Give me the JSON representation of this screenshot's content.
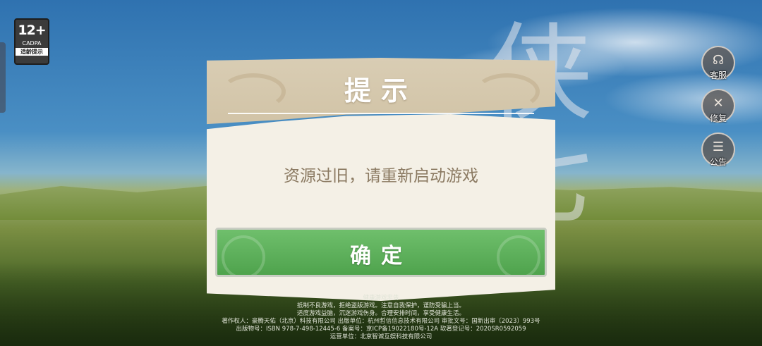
{
  "age_rating": {
    "number": "12+",
    "org": "CADPA",
    "label": "适龄提示"
  },
  "side_menu": [
    {
      "label": "客服",
      "icon": "customer-service-icon",
      "glyph": "☊"
    },
    {
      "label": "修复",
      "icon": "wrench-screwdriver-icon",
      "glyph": "✕"
    },
    {
      "label": "公告",
      "icon": "announcement-icon",
      "glyph": "☰"
    }
  ],
  "dialog": {
    "title": "提示",
    "message": "资源过旧，请重新启动游戏",
    "confirm_label": "确定"
  },
  "footer": {
    "heading": "健康游戏忠告",
    "line1": "抵制不良游戏，拒绝盗版游戏。注意自我保护，谨防受骗上当。",
    "line2": "适度游戏益脑，沉迷游戏伤身。合理安排时间，享受健康生活。",
    "line3": "著作权人：豪腾天佑（北京）科技有限公司   出版单位：杭州哲信信息技术有限公司   审批文号：国新出审〔2023〕993号",
    "line4": "出版物号：ISBN 978-7-498-12445-6   备案号：京ICP备19022180号-12A   软著登记号：2020SR0592059",
    "line5": "运营单位：北京智诚互娱科技有限公司"
  }
}
